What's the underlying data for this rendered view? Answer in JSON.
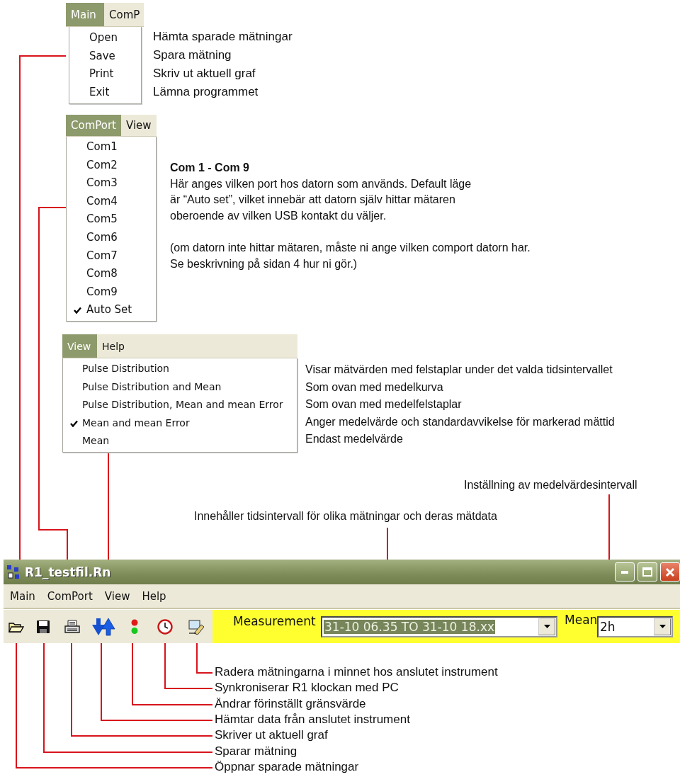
{
  "main_menu": {
    "menus": [
      {
        "label": "Main",
        "selected": true
      },
      {
        "label": "ComP",
        "selected": false
      }
    ],
    "items": [
      {
        "label": "Open",
        "description": "Hämta sparade mätningar"
      },
      {
        "label": "Save",
        "description": "Spara mätning"
      },
      {
        "label": "Print",
        "description": "Skriv ut aktuell graf"
      },
      {
        "label": "Exit",
        "description": "Lämna programmet"
      }
    ]
  },
  "comport_menu": {
    "menus": [
      {
        "label": "ComPort",
        "selected": true
      },
      {
        "label": "View",
        "selected": false
      }
    ],
    "items": [
      {
        "label": "Com1",
        "checked": false
      },
      {
        "label": "Com2",
        "checked": false
      },
      {
        "label": "Com3",
        "checked": false
      },
      {
        "label": "Com4",
        "checked": false
      },
      {
        "label": "Com5",
        "checked": false
      },
      {
        "label": "Com6",
        "checked": false
      },
      {
        "label": "Com7",
        "checked": false
      },
      {
        "label": "Com8",
        "checked": false
      },
      {
        "label": "Com9",
        "checked": false
      },
      {
        "label": "Auto Set",
        "checked": true
      }
    ]
  },
  "comport_note": {
    "heading": "Com 1 - Com 9",
    "paragraphs": [
      [
        "Här anges vilken port hos datorn som används. Default läge",
        "är “Auto set”, vilket innebär att datorn själv hittar mätaren",
        "oberoende av vilken USB kontakt du väljer."
      ],
      [
        "(om datorn inte hittar mätaren, måste ni ange vilken comport datorn har.",
        "Se beskrivning på sidan 4 hur ni gör.)"
      ]
    ]
  },
  "view_menu": {
    "menus": [
      {
        "label": "View",
        "selected": true
      },
      {
        "label": "Help",
        "selected": false
      }
    ],
    "items": [
      {
        "label": "Pulse Distribution",
        "checked": false,
        "description": "Visar mätvärden med felstaplar under det valda tidsintervallet"
      },
      {
        "label": "Pulse Distribution and Mean",
        "checked": false,
        "description": "Som ovan med medelkurva"
      },
      {
        "label": "Pulse Distribution, Mean and mean Error",
        "checked": false,
        "description": "Som ovan med medelfelstaplar"
      },
      {
        "label": "Mean and mean Error",
        "checked": true,
        "description": "Anger medelvärde och standardavvikelse för markerad mättid"
      },
      {
        "label": "Mean",
        "checked": false,
        "description": "Endast medelvärde"
      }
    ]
  },
  "callouts": {
    "mean_interval": "Inställning av medelvärdesintervall",
    "measurement": "Innehåller tidsintervall för olika mätningar och deras mätdata"
  },
  "window": {
    "title": "R1_testfil.Rn",
    "menus": [
      "Main",
      "ComPort",
      "View",
      "Help"
    ],
    "toolbar": [
      {
        "kind": "open"
      },
      {
        "kind": "save"
      },
      {
        "kind": "print"
      },
      {
        "kind": "transfer"
      },
      {
        "kind": "limit"
      },
      {
        "kind": "clock"
      },
      {
        "kind": "erase"
      }
    ],
    "measurement": {
      "label": "Measurement",
      "value": "31-10 06.35 TO 31-10 18.xx"
    },
    "mean": {
      "label": "Mean",
      "value": "2h"
    }
  },
  "toolbar_notes": [
    "Radera mätningarna i minnet hos anslutet instrument",
    "Synkroniserar R1 klockan med PC",
    "Ändrar förinställt gränsvärde",
    "Hämtar data från anslutet instrument",
    "Skriver ut aktuell graf",
    "Sparar mätning",
    "Öppnar sparade mätningar"
  ]
}
